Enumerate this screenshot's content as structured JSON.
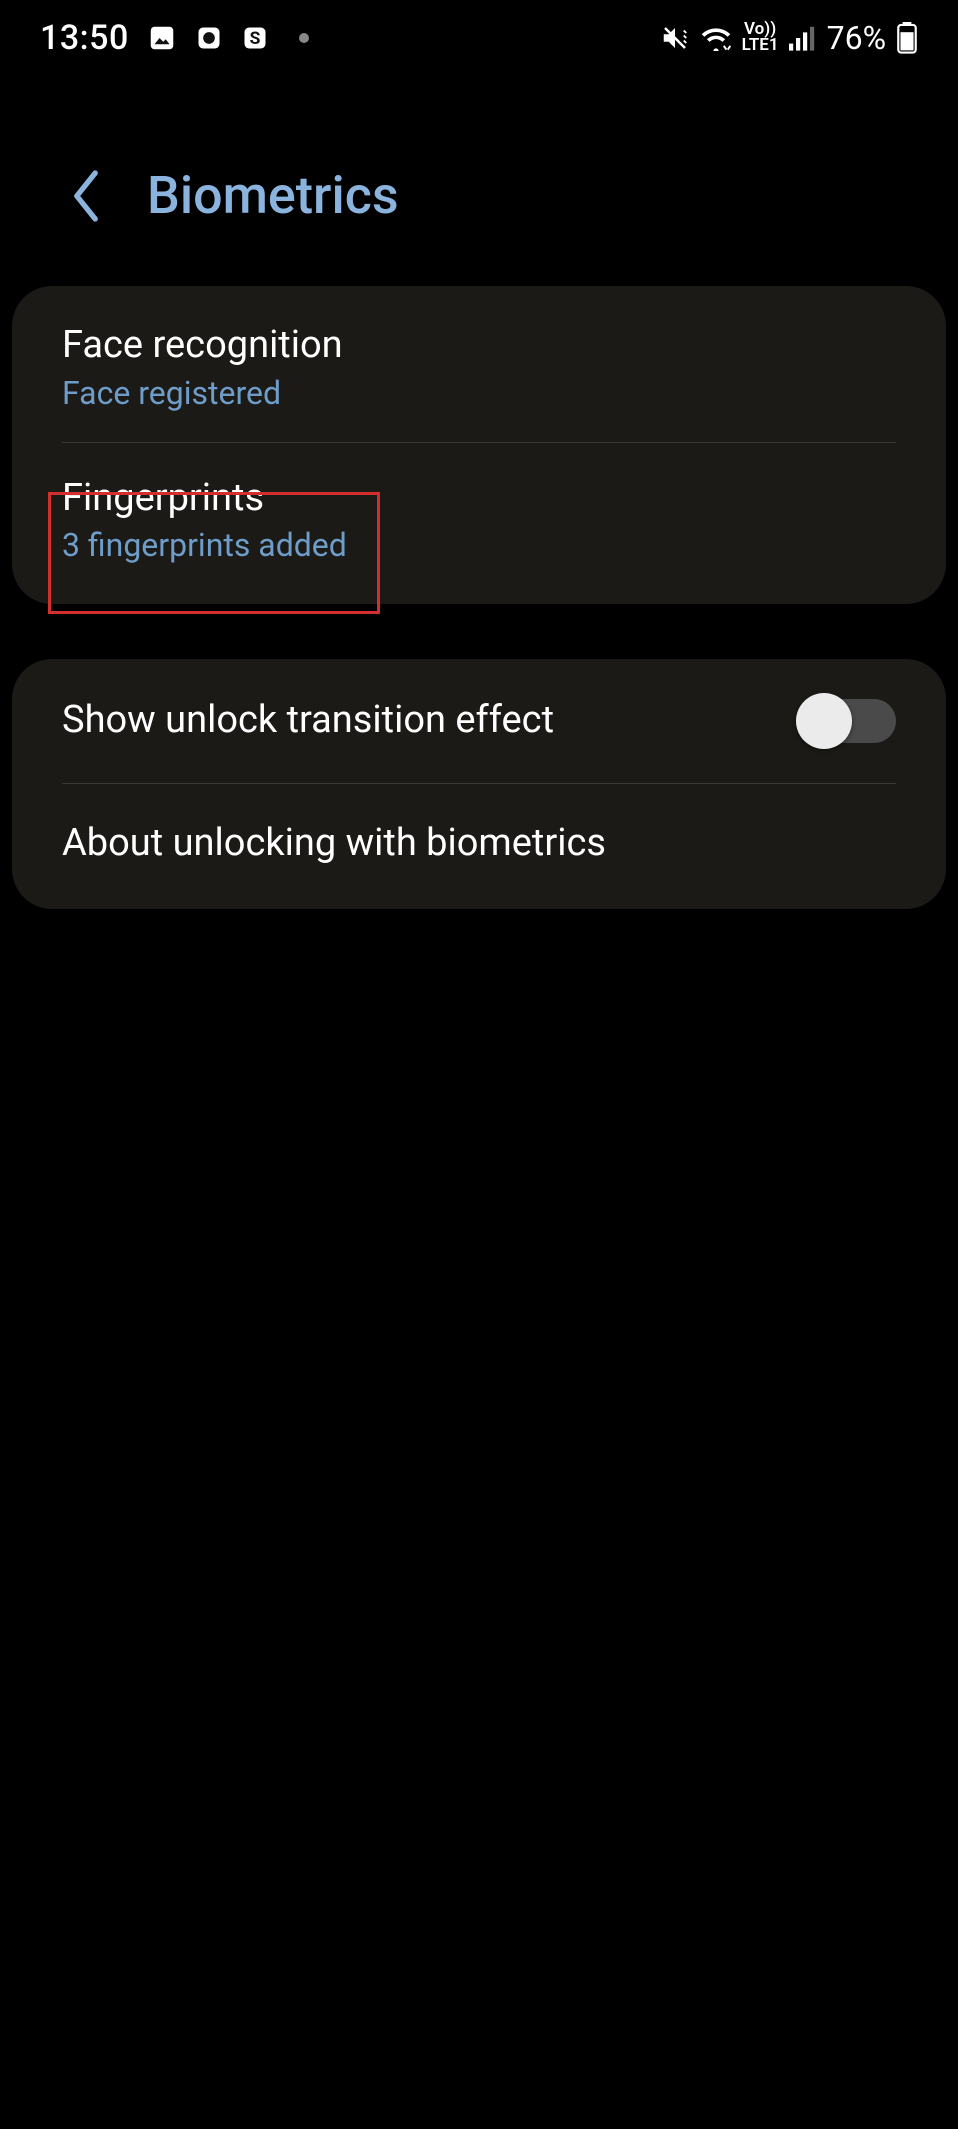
{
  "status": {
    "time": "13:50",
    "battery": "76%",
    "vo": "Vo))",
    "lte": "LTE1"
  },
  "header": {
    "title": "Biometrics"
  },
  "section1": {
    "face": {
      "title": "Face recognition",
      "sub": "Face registered"
    },
    "fingerprints": {
      "title": "Fingerprints",
      "sub": "3 fingerprints added"
    }
  },
  "section2": {
    "transition": {
      "title": "Show unlock transition effect"
    },
    "about": {
      "title": "About unlocking with biometrics"
    }
  }
}
